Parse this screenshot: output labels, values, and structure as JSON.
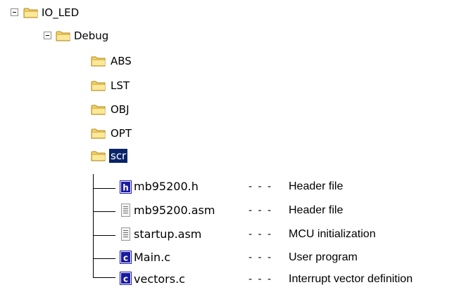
{
  "tree": {
    "root": {
      "label": "IO_LED"
    },
    "debug": {
      "label": "Debug"
    },
    "folders": [
      {
        "label": "ABS"
      },
      {
        "label": "LST"
      },
      {
        "label": "OBJ"
      },
      {
        "label": "OPT"
      },
      {
        "label": "scr"
      }
    ],
    "files": [
      {
        "name": "mb95200.h",
        "icon": "h-file-icon",
        "separator": "- - -",
        "description": "Header file"
      },
      {
        "name": "mb95200.asm",
        "icon": "asm-file-icon",
        "separator": "- - -",
        "description": "Header file"
      },
      {
        "name": "startup.asm",
        "icon": "asm-file-icon",
        "separator": "- - -",
        "description": "MCU initialization"
      },
      {
        "name": "Main.c",
        "icon": "c-file-icon",
        "separator": "- - -",
        "description": "User program"
      },
      {
        "name": "vectors.c",
        "icon": "c-file-icon",
        "separator": "- - -",
        "description": "Interrupt vector definition"
      }
    ]
  },
  "colors": {
    "selection": "#0a246a",
    "folder": "#f3d36b",
    "icon_blue": "#1a1aa0"
  }
}
